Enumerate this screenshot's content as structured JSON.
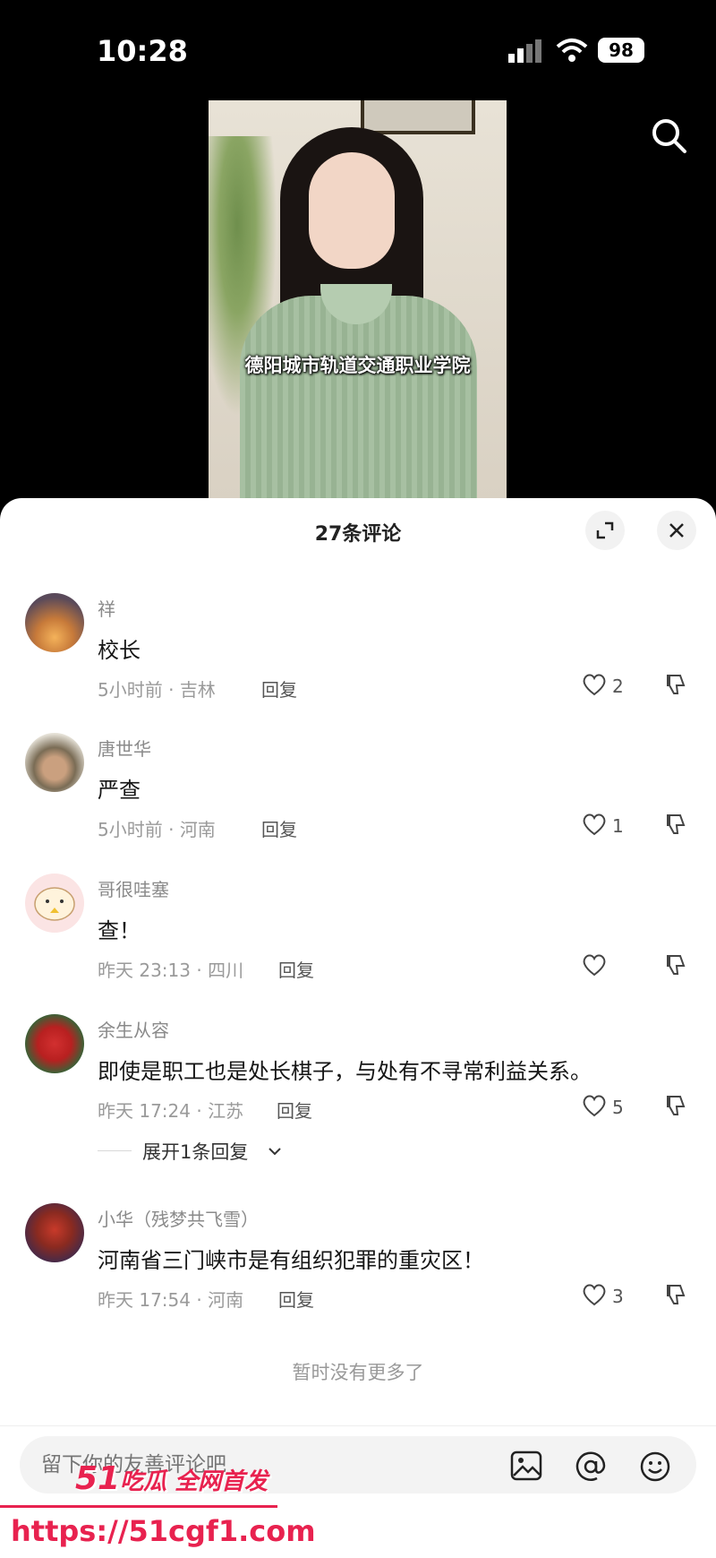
{
  "status": {
    "time": "10:28",
    "battery": "98"
  },
  "video": {
    "caption": "德阳城市轨道交通职业学院"
  },
  "sheet": {
    "title": "27条评论"
  },
  "comments": [
    {
      "name": "祥",
      "text": "校长",
      "time": "5小时前",
      "location": "吉林",
      "reply": "回复",
      "likes": "2"
    },
    {
      "name": "唐世华",
      "text": "严查",
      "time": "5小时前",
      "location": "河南",
      "reply": "回复",
      "likes": "1"
    },
    {
      "name": "哥很哇塞",
      "text": "查！",
      "time": "昨天 23:13",
      "location": "四川",
      "reply": "回复",
      "likes": ""
    },
    {
      "name": "余生从容",
      "text": "即使是职工也是处长棋子，与处有不寻常利益关系。",
      "time": "昨天 17:24",
      "location": "江苏",
      "reply": "回复",
      "likes": "5"
    },
    {
      "name": "小华（残梦共飞雪）",
      "text": "河南省三门峡市是有组织犯罪的重灾区！",
      "time": "昨天 17:54",
      "location": "河南",
      "reply": "回复",
      "likes": "3"
    }
  ],
  "expand_replies": "展开1条回复",
  "no_more": "暂时没有更多了",
  "input": {
    "placeholder": "留下你的友善评论吧"
  },
  "watermark": {
    "brand": "51",
    "slogan": "吃瓜 全网首发",
    "url": "https://51cgf1.com"
  },
  "colors": {
    "accent": "#e8224f"
  }
}
